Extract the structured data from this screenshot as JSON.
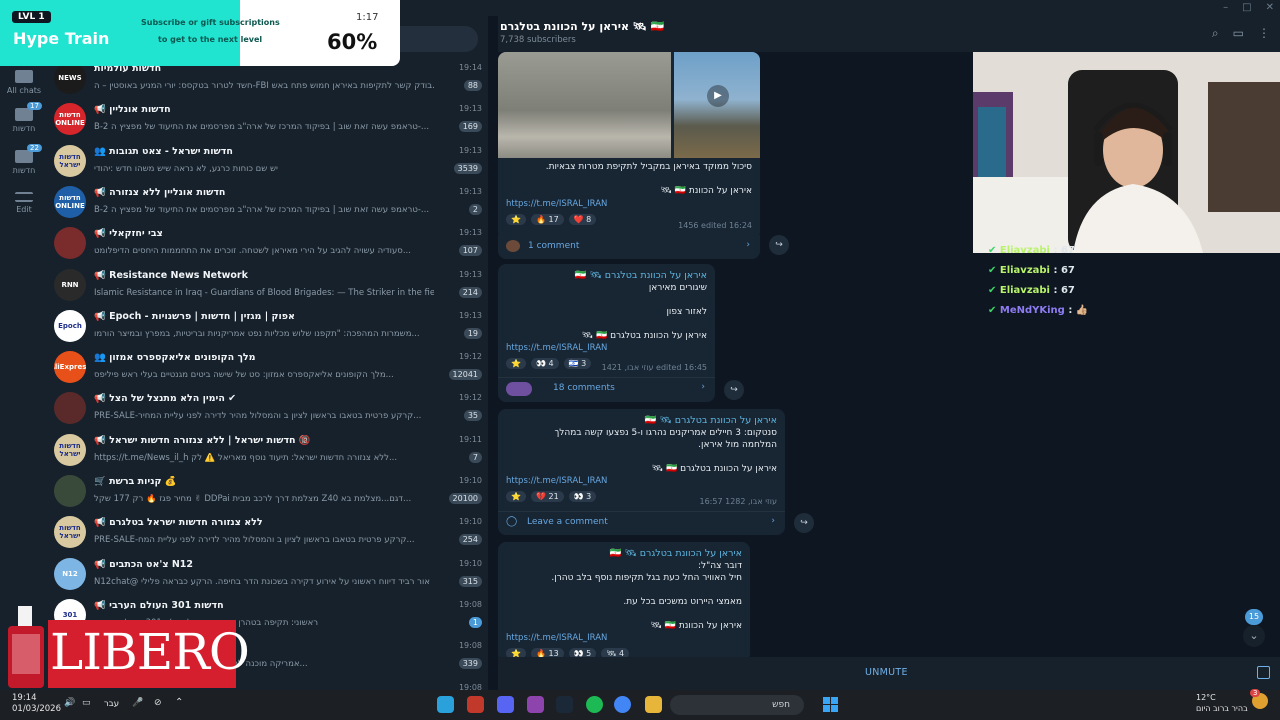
{
  "window": {
    "controls": [
      "–",
      "□",
      "✕"
    ]
  },
  "rail": [
    {
      "label": "All chats",
      "badge": ""
    },
    {
      "label": "חדשות",
      "badge": "17"
    },
    {
      "label": "חדשות",
      "badge": "22"
    },
    {
      "label": "Edit",
      "badge": ""
    }
  ],
  "chats": [
    {
      "title": "חדשות עולמיות",
      "time": "19:14",
      "preview": "חשד לטרור בטקסס: יורי המניע באוסטין – ה-FBI בודק קשר לתקיפות באיראן  חמוש פתח באש...",
      "count": "88",
      "av": "#1b1b1b",
      "avtext": "NEWS"
    },
    {
      "title": "📢 חדשות אונליין",
      "time": "19:13",
      "preview": "B-2 טראמפ עשה זאת שוב | בפיקוד המרכז של ארה\"ב מפרסמים את התיעוד של מפציץ ה-...",
      "count": "169",
      "av": "#d6262b",
      "avtext": "חדשות ONLINE"
    },
    {
      "title": "👥 חדשות ישראל - צאט תגובות",
      "time": "19:13",
      "preview": "יש שם כוחות כרגע, לא נראה שיש משהו חדש :יהודי",
      "count": "3539",
      "av": "#d8c9a0",
      "avtext": "חדשות ישראל"
    },
    {
      "title": "📢 חדשות אונליין ללא צנזורה",
      "time": "19:13",
      "preview": "B-2 טראמפ עשה זאת שוב | בפיקוד המרכז של ארה\"ב מפרסמים את התיעוד של מפציץ ה-...",
      "count": "2",
      "av": "#1f5fa8",
      "avtext": "חדשות ONLINE"
    },
    {
      "title": "📢 צבי יחזקאלי",
      "time": "19:13",
      "preview": "סעודיה עשויה להגיב על הירי מאיראן לשטחה. זוכרים את התחממות היחסים הדיפלומט...",
      "count": "107",
      "av": "#7a2b2b",
      "avtext": ""
    },
    {
      "title": "📢 Resistance News Network",
      "time": "19:13",
      "preview": "Islamic Resistance in Iraq - Guardians of Blood Brigades: — The Striker in the field. The ...",
      "count": "214",
      "av": "#2a2a2a",
      "avtext": "RNN"
    },
    {
      "title": "📢 Epoch - אפוק | מגזין | חדשות | פרשנויות",
      "time": "19:13",
      "preview": "משמרות המהפכה: \"תקפנו שלוש מכליות נפט אמריקניות ובריטיות, במפרץ ובמיצר הורמו...",
      "count": "19",
      "av": "#ffffff",
      "avtext": "Epoch"
    },
    {
      "title": "👥 מלך הקופונים אליאקספרס אמזון",
      "time": "19:12",
      "preview": "מלך הקופונים אליאקספרס אמזון: סט של שישה ביטים מגנטיים בעלי ראש פיליפס...",
      "count": "12041",
      "av": "#e8501a",
      "avtext": "AliExpress"
    },
    {
      "title": "📢 הימין הלא מתנצל של הצל ✔",
      "time": "19:12",
      "preview": "PRE-SALE-קרקע פרטית בטאבו בראשון לציון ב והמסלול מהיר לדירה לפני עליית המחיר...",
      "count": "35",
      "av": "#5a2a2a",
      "avtext": ""
    },
    {
      "title": "📢 חדשות ישראל | ללא צנזורה חדשות ישראל 🔞",
      "time": "19:11",
      "preview": "https://t.me/News_il_h  ללא צנזורה חדשות ישראל: תיעוד נוסף מאריאל ⚠️ לק...",
      "count": "7",
      "av": "#d8c9a0",
      "avtext": "חדשות ישראל"
    },
    {
      "title": "🛒 קניות ברשת 💰",
      "time": "19:10",
      "preview": "מחיר פגז 🔥 רק 177 שקל ✌ DDPai מצלמת דרך לרכב מבית Z40 דגם...מצלמת בא...",
      "count": "20100",
      "av": "#3a4a3a",
      "avtext": ""
    },
    {
      "title": "📢 ללא צנזורה חדשות ישראל בטלגרם",
      "time": "19:10",
      "preview": "PRE-SALE-קרקע פרטית בטאבו בראשון לציון ב והמסלול מהיר לדירה לפני עליית המח...",
      "count": "254",
      "av": "#d8c9a0",
      "avtext": "חדשות ישראל"
    },
    {
      "title": "📢 צ'אט הכתבים N12",
      "time": "19:10",
      "preview": "N12chat@ אור רביד דיווח ראשוני על אירוע דקירה בשכונת הדר בחיפה. הרקע כבראה פלילי",
      "count": "315",
      "av": "#7db6e4",
      "avtext": "N12"
    },
    {
      "title": "📢 חדשות 301 העולם הערבי",
      "time": "19:08",
      "preview": "ראשוני: תקיפה בטהרן כעת. יאיר גולד בלט 301 העולם הערבי",
      "count": "1",
      "av": "#ffffff",
      "avtext": "301"
    },
    {
      "title": "📢 חדשות",
      "time": "19:08",
      "preview": "הסנטור לינדזי גראהם ל- NBC: \"אמריקה מוכנה למערכה...",
      "count": "339",
      "av": "#2a2a2a",
      "avtext": ""
    },
    {
      "title": "",
      "time": "19:08",
      "preview": "",
      "count": "",
      "av": "#17212b",
      "avtext": ""
    }
  ],
  "channel": {
    "title": "איראן על הכוונת בטלגרם 🛰 🇮🇷",
    "subscribers": "7,738 subscribers"
  },
  "messages": [
    {
      "id": "m1",
      "lines": [
        "סיכול ממוקד באיראן במקביל לתקיפת מטרות צבאיות.",
        "איראן על הכוונת 🇮🇷 🛰"
      ],
      "link": "https://t.me/ISRAL_IRAN",
      "reactions": [
        "⭐",
        "🔥 17",
        "❤️ 8"
      ],
      "meta": "1456  edited 16:24",
      "comment": "1 comment"
    },
    {
      "id": "m2",
      "header": "איראן על הכוונת בטלגרם 🛰 🇮🇷",
      "lines": [
        "שיגורים מאיראן",
        "לאזור צפון",
        "איראן על הכוונת בטלגרם 🇮🇷 🛰"
      ],
      "link": "https://t.me/ISRAL_IRAN",
      "reactions": [
        "⭐",
        "👀 4",
        "🇮🇱 3"
      ],
      "meta": "עוזי אבו, 1421  edited 16:45",
      "comment": "18 comments"
    },
    {
      "id": "m3",
      "header": "איראן על הכוונת בטלגרם 🛰 🇮🇷",
      "lines": [
        "סנטקום: 3 חיילים אמריקנים נהרגו ו-5 נפצעו קשה במהלך",
        "המלחמה מול איראן.",
        "איראן על הכוונת בטלגרם 🇮🇷 🛰"
      ],
      "link": "https://t.me/ISRAL_IRAN",
      "reactions": [
        "⭐",
        "💔 21",
        "👀 3"
      ],
      "meta": "עוזי אבו, 1282  16:57",
      "comment": "Leave a comment"
    },
    {
      "id": "m4",
      "header": "איראן על הכוונת בטלגרם 🛰 🇮🇷",
      "lines": [
        "דובר צה\"ל:",
        "חיל האוויר החל כעת בגל תקיפות נוסף בלב טהרן.",
        "מאמצי היירוט נמשכים בכל עת.",
        "איראן על הכוונת 🇮🇷 🛰"
      ],
      "link": "https://t.me/ISRAL_IRAN",
      "reactions": [
        "⭐",
        "🔥 13",
        "👀 5",
        "🛰 4"
      ],
      "meta": "",
      "comment": ""
    }
  ],
  "scroll_badge": "15",
  "stream_chat": [
    {
      "user": "Eliavzabi",
      "text": ": 67"
    },
    {
      "user": "Eliavzabi",
      "text": ": 67"
    },
    {
      "user": "Eliavzabi",
      "text": ": 67"
    },
    {
      "user": "MeNdYKing",
      "text": ": 👍🏼"
    }
  ],
  "hype": {
    "level": "LVL 1",
    "title": "Hype Train",
    "sub1": "Subscribe or gift subscriptions",
    "sub2": "to get to the next level",
    "timer": "1:17",
    "progress": "60%",
    "progress_value": 0.6
  },
  "libero": "LIBERO",
  "unmute": "UNMUTE",
  "taskbar": {
    "time": "19:14",
    "date": "01/03/2026",
    "lang": "עבר",
    "search": "חפש",
    "temp": "12°C",
    "weather": "בהיר ברוב היום",
    "weather_badge": "3"
  },
  "colors": {
    "accent": "#5fb8e3",
    "bg": "#0e1621",
    "panel": "#17212b",
    "hype": "#20e3d0"
  }
}
